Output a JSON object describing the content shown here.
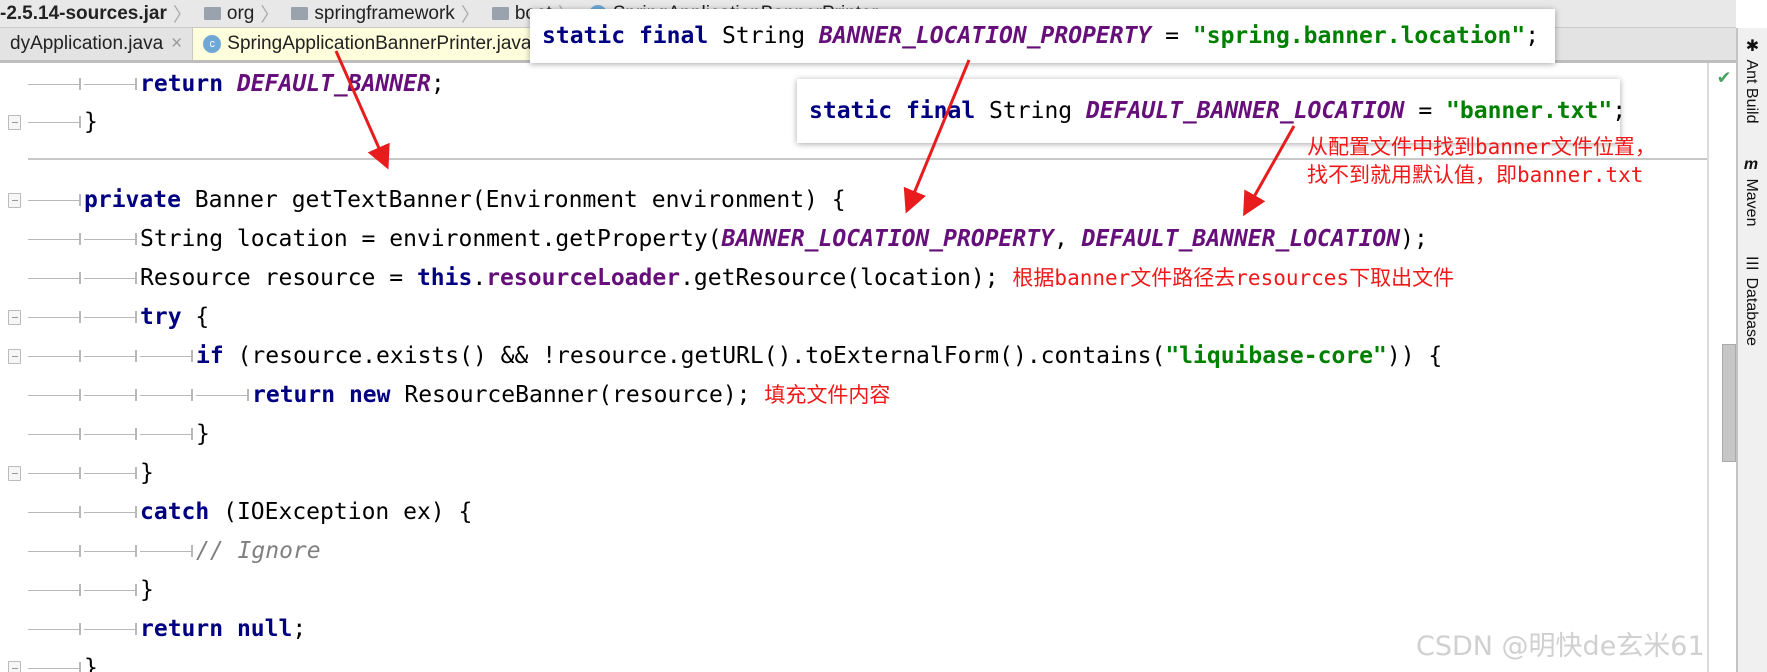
{
  "breadcrumb": [
    {
      "label": "-2.5.14-sources.jar",
      "icon": "none"
    },
    {
      "label": "org",
      "icon": "folder-icon"
    },
    {
      "label": "springframework",
      "icon": "folder-icon"
    },
    {
      "label": "boot",
      "icon": "folder-icon"
    },
    {
      "label": "SpringApplicationBannerPrinter",
      "icon": "class-icon"
    }
  ],
  "tabs": [
    {
      "label": "dyApplication.java",
      "close": "×"
    },
    {
      "label": "SpringApplicationBannerPrinter.java",
      "icon": "c",
      "active": true
    }
  ],
  "tooltips": [
    {
      "tokens": [
        [
          "static",
          "kw"
        ],
        [
          " "
        ],
        [
          "final",
          "kw"
        ],
        [
          " String "
        ],
        [
          "BANNER_LOCATION_PROPERTY",
          "const"
        ],
        [
          " = "
        ],
        [
          "\"spring.banner.location\"",
          "str"
        ],
        [
          ";"
        ]
      ]
    },
    {
      "tokens": [
        [
          "static",
          "kw"
        ],
        [
          " "
        ],
        [
          "final",
          "kw"
        ],
        [
          " String "
        ],
        [
          "DEFAULT_BANNER_LOCATION",
          "const"
        ],
        [
          " = "
        ],
        [
          "\"banner.txt\"",
          "str"
        ],
        [
          ";"
        ]
      ]
    }
  ],
  "code": [
    {
      "indent": 2,
      "tokens": [
        [
          "return",
          "kw"
        ],
        [
          " "
        ],
        [
          "DEFAULT_BANNER",
          "const"
        ],
        [
          ";"
        ]
      ]
    },
    {
      "indent": 1,
      "fold": true,
      "tokens": [
        [
          "}"
        ]
      ]
    },
    {
      "indent": 1,
      "fold": true,
      "tokens": [
        [
          "private",
          "kw"
        ],
        [
          " Banner getTextBanner(Environment environment) {"
        ]
      ]
    },
    {
      "indent": 2,
      "tokens": [
        [
          "String location = environment.getProperty("
        ],
        [
          "BANNER_LOCATION_PROPERTY",
          "const"
        ],
        [
          ", "
        ],
        [
          "DEFAULT_BANNER_LOCATION",
          "const"
        ],
        [
          ");"
        ]
      ]
    },
    {
      "indent": 2,
      "tokens": [
        [
          "Resource resource = "
        ],
        [
          "this",
          "kw"
        ],
        [
          "."
        ],
        [
          "resourceLoader",
          "field"
        ],
        [
          ".getResource(location); "
        ],
        [
          "根据banner文件路径去resources下取出文件",
          "note"
        ]
      ]
    },
    {
      "indent": 2,
      "fold": true,
      "tokens": [
        [
          "try",
          "kw"
        ],
        [
          " {"
        ]
      ]
    },
    {
      "indent": 3,
      "fold": true,
      "tokens": [
        [
          "if",
          "kw"
        ],
        [
          " (resource.exists() && !resource.getURL().toExternalForm().contains("
        ],
        [
          "\"liquibase-core\"",
          "str"
        ],
        [
          ")) {"
        ]
      ]
    },
    {
      "indent": 4,
      "tokens": [
        [
          "return",
          "kw"
        ],
        [
          " "
        ],
        [
          "new",
          "kw"
        ],
        [
          " ResourceBanner(resource); "
        ],
        [
          "填充文件内容",
          "note"
        ]
      ]
    },
    {
      "indent": 3,
      "tokens": [
        [
          "}"
        ]
      ]
    },
    {
      "indent": 2,
      "fold": true,
      "tokens": [
        [
          "}"
        ]
      ]
    },
    {
      "indent": 2,
      "tokens": [
        [
          "catch",
          "kw"
        ],
        [
          " (IOException ex) {"
        ]
      ]
    },
    {
      "indent": 3,
      "tokens": [
        [
          "// Ignore",
          "cmt"
        ]
      ]
    },
    {
      "indent": 2,
      "tokens": [
        [
          "}"
        ]
      ]
    },
    {
      "indent": 2,
      "tokens": [
        [
          "return",
          "kw"
        ],
        [
          " "
        ],
        [
          "null",
          "kw"
        ],
        [
          ";"
        ]
      ]
    },
    {
      "indent": 1,
      "fold": true,
      "tokens": [
        [
          "}"
        ]
      ]
    }
  ],
  "annotations": {
    "line1": "从配置文件中找到banner文件位置，",
    "line2": "找不到就用默认值，即banner.txt"
  },
  "right_tools": [
    {
      "label": "Ant Build",
      "icon": "ant-icon"
    },
    {
      "label": "Maven",
      "icon": "maven-icon"
    },
    {
      "label": "Database",
      "icon": "database-icon"
    }
  ],
  "watermark": "CSDN @明快de玄米61",
  "colors": {
    "keyword": "#000080",
    "constant": "#660e7a",
    "string": "#008000",
    "annotation": "#f01818"
  }
}
